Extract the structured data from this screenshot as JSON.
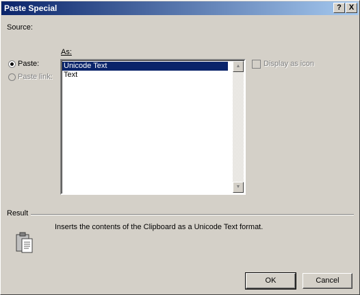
{
  "window": {
    "title": "Paste Special",
    "help_glyph": "?",
    "close_glyph": "X"
  },
  "source": {
    "label": "Source:"
  },
  "as": {
    "label": "As:"
  },
  "options": {
    "paste": {
      "label": "Paste:",
      "checked": true
    },
    "paste_link": {
      "label": "Paste link:",
      "checked": false
    }
  },
  "list": {
    "items": [
      "Unicode Text",
      "Text"
    ],
    "selected_index": 0
  },
  "scrollbar": {
    "up_glyph": "▲",
    "down_glyph": "▼"
  },
  "display_icon": {
    "label": "Display as icon",
    "checked": false
  },
  "result": {
    "label": "Result",
    "description": "Inserts the contents of the Clipboard as a Unicode Text format."
  },
  "buttons": {
    "ok": "OK",
    "cancel": "Cancel"
  },
  "icons": {
    "result_icon": "clipboard-paste-icon"
  }
}
